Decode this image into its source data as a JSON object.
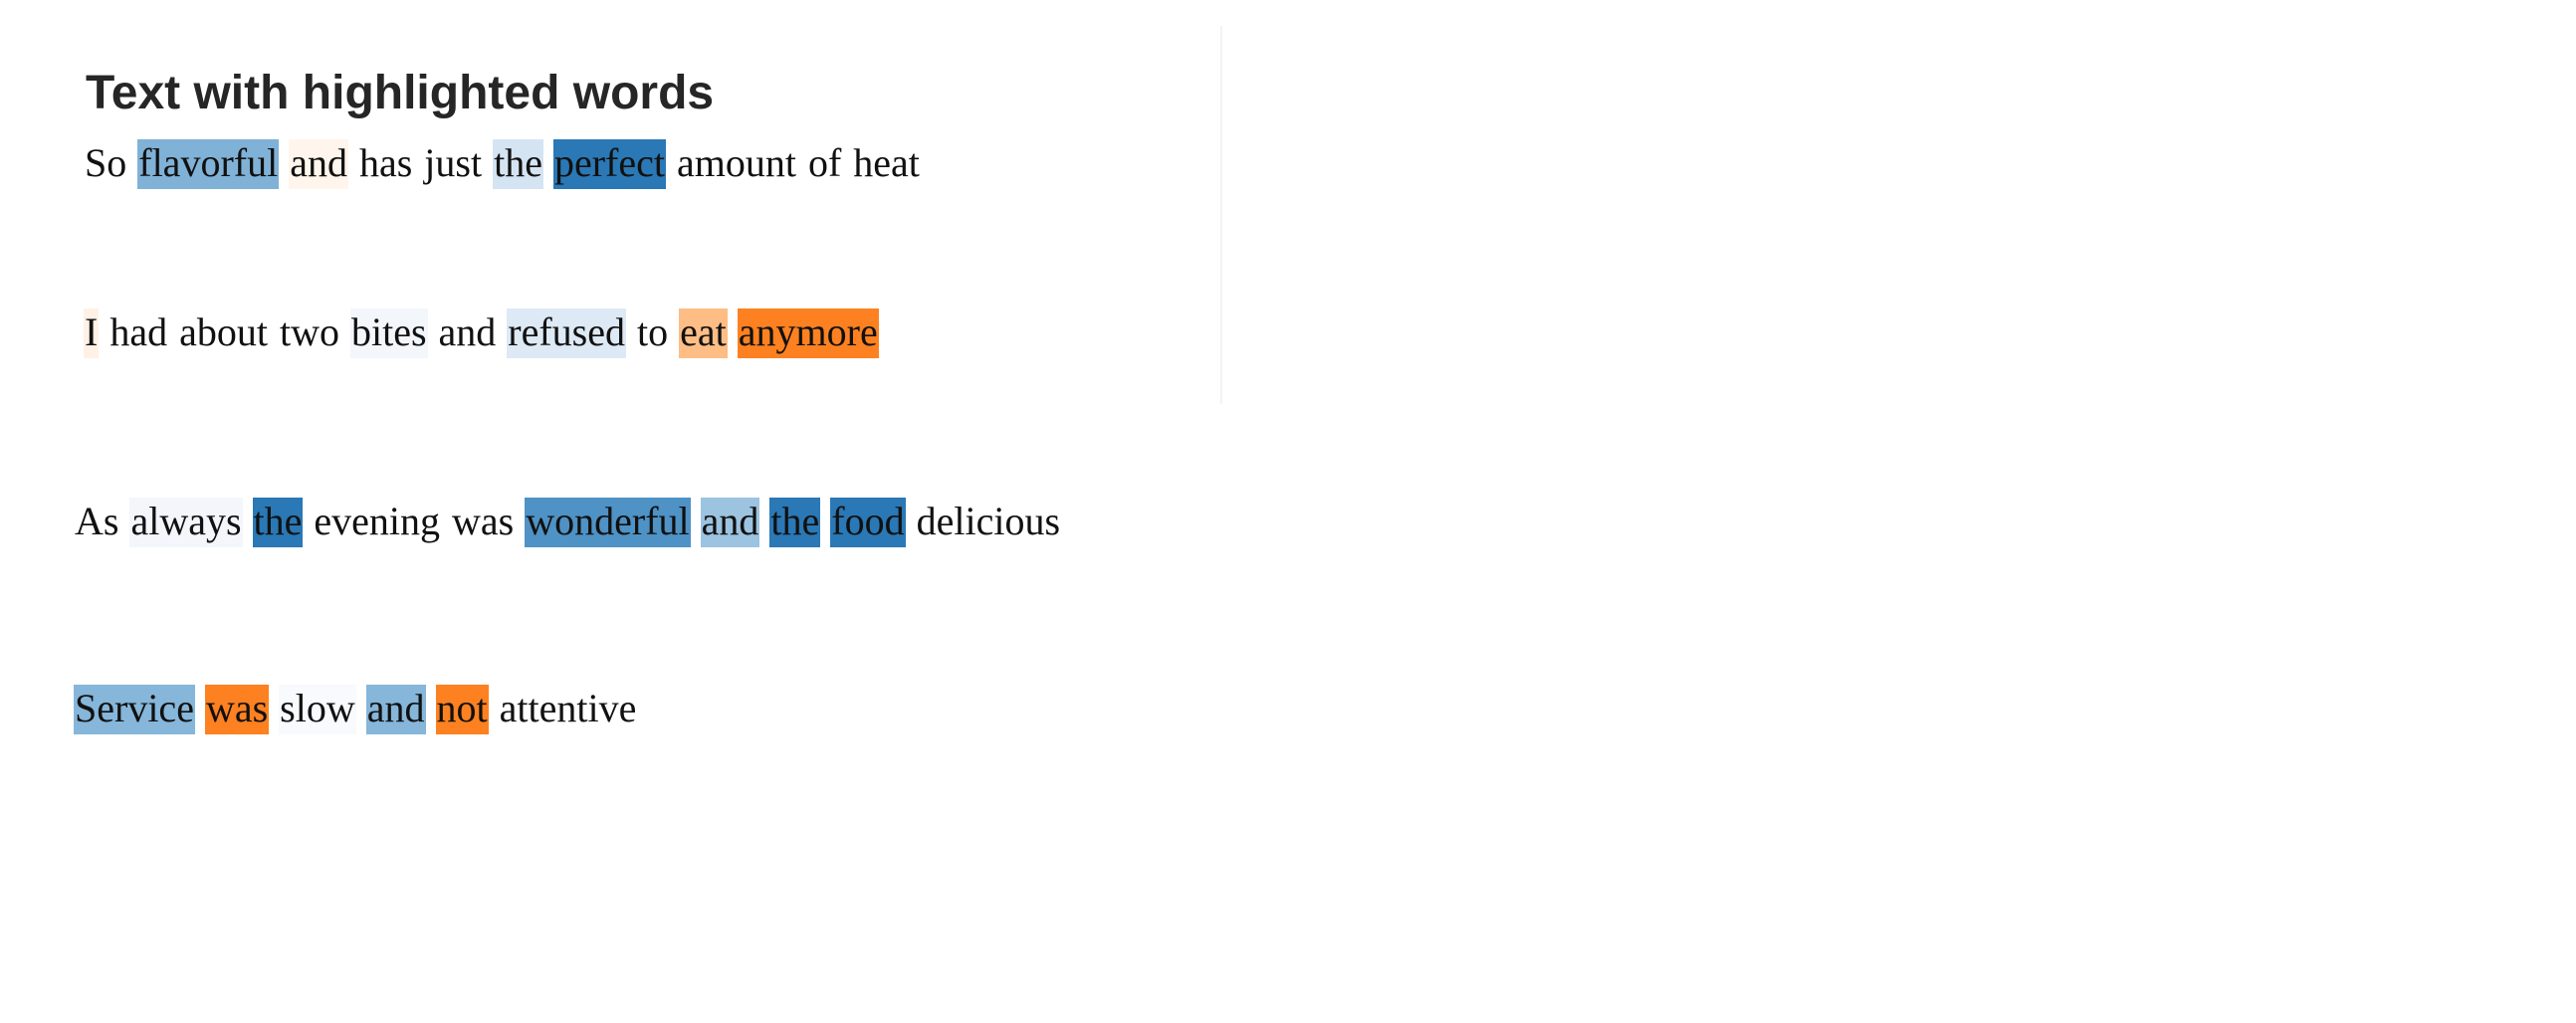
{
  "chart_data": {
    "type": "text-highlight",
    "title": "Text with highlighted words",
    "sentences": [
      {
        "words": [
          {
            "text": "So",
            "color": "#ffffff"
          },
          {
            "text": "flavorful",
            "color": "#80b1d6"
          },
          {
            "text": "and",
            "color": "#fff5ec"
          },
          {
            "text": "has",
            "color": "#ffffff"
          },
          {
            "text": "just",
            "color": "#ffffff"
          },
          {
            "text": "the",
            "color": "#d5e4f2"
          },
          {
            "text": "perfect",
            "color": "#2a78b5"
          },
          {
            "text": "amount",
            "color": "#ffffff"
          },
          {
            "text": "of",
            "color": "#ffffff"
          },
          {
            "text": "heat",
            "color": "#ffffff"
          }
        ]
      },
      {
        "words": [
          {
            "text": "I",
            "color": "#fff1e6"
          },
          {
            "text": "had",
            "color": "#ffffff"
          },
          {
            "text": "about",
            "color": "#ffffff"
          },
          {
            "text": "two",
            "color": "#ffffff"
          },
          {
            "text": "bites",
            "color": "#f3f7fc"
          },
          {
            "text": "and",
            "color": "#ffffff"
          },
          {
            "text": "refused",
            "color": "#dde9f5"
          },
          {
            "text": "to",
            "color": "#ffffff"
          },
          {
            "text": "eat",
            "color": "#fdbd85"
          },
          {
            "text": "anymore",
            "color": "#fd8120"
          }
        ]
      },
      {
        "words": [
          {
            "text": "As",
            "color": "#ffffff"
          },
          {
            "text": "always",
            "color": "#f3f7fc"
          },
          {
            "text": "the",
            "color": "#2a78b5"
          },
          {
            "text": "evening",
            "color": "#ffffff"
          },
          {
            "text": "was",
            "color": "#ffffff"
          },
          {
            "text": "wonderful",
            "color": "#4f92c5"
          },
          {
            "text": "and",
            "color": "#9cc3e0"
          },
          {
            "text": "the",
            "color": "#2a78b5"
          },
          {
            "text": "food",
            "color": "#2a78b5"
          },
          {
            "text": "delicious",
            "color": "#ffffff"
          }
        ]
      },
      {
        "words": [
          {
            "text": "Service",
            "color": "#86b6d9"
          },
          {
            "text": "was",
            "color": "#fd8120"
          },
          {
            "text": "slow",
            "color": "#f8fafd"
          },
          {
            "text": "and",
            "color": "#86b6d9"
          },
          {
            "text": "not",
            "color": "#fd8120"
          },
          {
            "text": "attentive",
            "color": "#ffffff"
          }
        ]
      }
    ]
  }
}
